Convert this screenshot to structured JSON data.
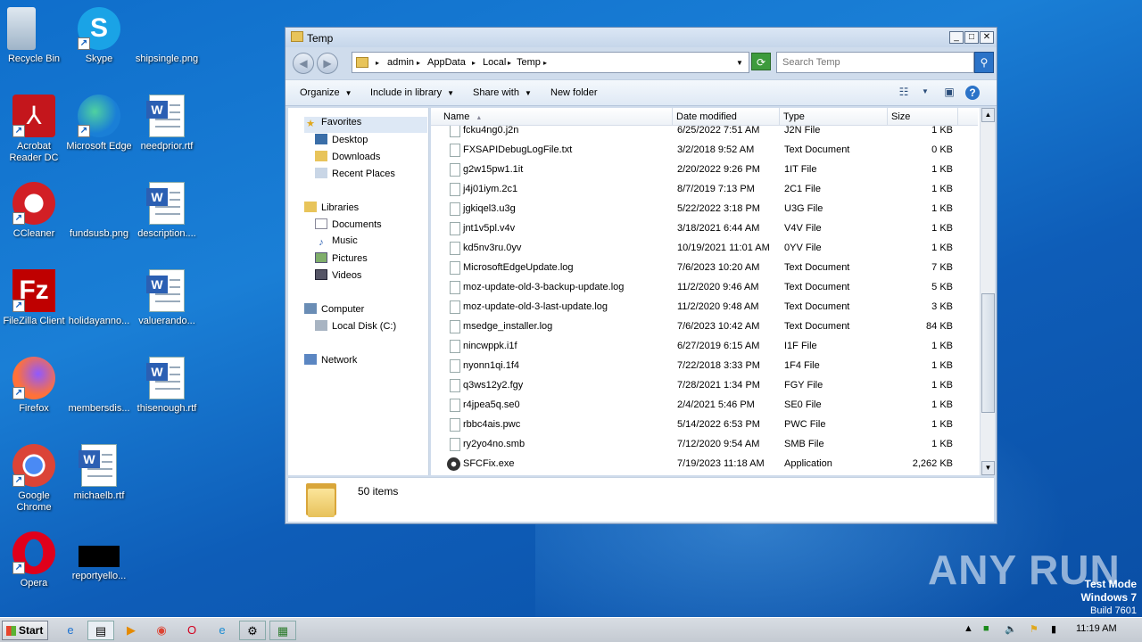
{
  "desktop": {
    "icons": [
      {
        "label": "Recycle Bin",
        "icon": "recycle-bin-icon"
      },
      {
        "label": "Skype",
        "icon": "skype-icon"
      },
      {
        "label": "shipsingle.png",
        "icon": "image-file-icon"
      },
      {
        "label": "Acrobat Reader DC",
        "icon": "acrobat-icon"
      },
      {
        "label": "Microsoft Edge",
        "icon": "edge-icon"
      },
      {
        "label": "needprior.rtf",
        "icon": "word-doc-icon"
      },
      {
        "label": "CCleaner",
        "icon": "ccleaner-icon"
      },
      {
        "label": "fundsusb.png",
        "icon": "image-file-icon"
      },
      {
        "label": "description....",
        "icon": "word-doc-icon"
      },
      {
        "label": "FileZilla Client",
        "icon": "filezilla-icon"
      },
      {
        "label": "holidayanno...",
        "icon": "image-file-icon"
      },
      {
        "label": "valuerando...",
        "icon": "word-doc-icon"
      },
      {
        "label": "Firefox",
        "icon": "firefox-icon"
      },
      {
        "label": "membersdis...",
        "icon": "image-file-icon"
      },
      {
        "label": "thisenough.rtf",
        "icon": "word-doc-icon"
      },
      {
        "label": "Google Chrome",
        "icon": "chrome-icon"
      },
      {
        "label": "michaelb.rtf",
        "icon": "word-doc-icon"
      },
      {
        "label": "Opera",
        "icon": "opera-icon"
      },
      {
        "label": "reportyello...",
        "icon": "black-image-icon"
      }
    ]
  },
  "window": {
    "title": "Temp",
    "controls": {
      "minimize": "_",
      "maximize": "□",
      "close": "✕"
    },
    "breadcrumbs": [
      "admin",
      "AppData",
      "Local",
      "Temp"
    ],
    "search_placeholder": "Search Temp",
    "toolbar": {
      "organize": "Organize",
      "include": "Include in library",
      "share": "Share with",
      "newfolder": "New folder"
    },
    "nav": {
      "favorites": "Favorites",
      "desktop": "Desktop",
      "downloads": "Downloads",
      "recent": "Recent Places",
      "libraries": "Libraries",
      "documents": "Documents",
      "music": "Music",
      "pictures": "Pictures",
      "videos": "Videos",
      "computer": "Computer",
      "localdisk": "Local Disk (C:)",
      "network": "Network"
    },
    "columns": {
      "name": "Name",
      "date": "Date modified",
      "type": "Type",
      "size": "Size"
    },
    "files": [
      {
        "name": "fcku4ng0.j2n",
        "date": "6/25/2022 7:51 AM",
        "type": "J2N File",
        "size": "1 KB"
      },
      {
        "name": "FXSAPIDebugLogFile.txt",
        "date": "3/2/2018 9:52 AM",
        "type": "Text Document",
        "size": "0 KB"
      },
      {
        "name": "g2w15pw1.1it",
        "date": "2/20/2022 9:26 PM",
        "type": "1IT File",
        "size": "1 KB"
      },
      {
        "name": "j4j01iym.2c1",
        "date": "8/7/2019 7:13 PM",
        "type": "2C1 File",
        "size": "1 KB"
      },
      {
        "name": "jgkiqel3.u3g",
        "date": "5/22/2022 3:18 PM",
        "type": "U3G File",
        "size": "1 KB"
      },
      {
        "name": "jnt1v5pl.v4v",
        "date": "3/18/2021 6:44 AM",
        "type": "V4V File",
        "size": "1 KB"
      },
      {
        "name": "kd5nv3ru.0yv",
        "date": "10/19/2021 11:01 AM",
        "type": "0YV File",
        "size": "1 KB"
      },
      {
        "name": "MicrosoftEdgeUpdate.log",
        "date": "7/6/2023 10:20 AM",
        "type": "Text Document",
        "size": "7 KB"
      },
      {
        "name": "moz-update-old-3-backup-update.log",
        "date": "11/2/2020 9:46 AM",
        "type": "Text Document",
        "size": "5 KB"
      },
      {
        "name": "moz-update-old-3-last-update.log",
        "date": "11/2/2020 9:48 AM",
        "type": "Text Document",
        "size": "3 KB"
      },
      {
        "name": "msedge_installer.log",
        "date": "7/6/2023 10:42 AM",
        "type": "Text Document",
        "size": "84 KB"
      },
      {
        "name": "nincwppk.i1f",
        "date": "6/27/2019 6:15 AM",
        "type": "I1F File",
        "size": "1 KB"
      },
      {
        "name": "nyonn1qi.1f4",
        "date": "7/22/2018 3:33 PM",
        "type": "1F4 File",
        "size": "1 KB"
      },
      {
        "name": "q3ws12y2.fgy",
        "date": "7/28/2021 1:34 PM",
        "type": "FGY File",
        "size": "1 KB"
      },
      {
        "name": "r4jpea5q.se0",
        "date": "2/4/2021 5:46 PM",
        "type": "SE0 File",
        "size": "1 KB"
      },
      {
        "name": "rbbc4ais.pwc",
        "date": "5/14/2022 6:53 PM",
        "type": "PWC File",
        "size": "1 KB"
      },
      {
        "name": "ry2yo4no.smb",
        "date": "7/12/2020 9:54 AM",
        "type": "SMB File",
        "size": "1 KB"
      },
      {
        "name": "SFCFix.exe",
        "date": "7/19/2023 11:18 AM",
        "type": "Application",
        "size": "2,262 KB"
      }
    ],
    "status": "50 items"
  },
  "watermark": {
    "text": "ANY RUN",
    "mode": "Test Mode",
    "os": "Windows 7",
    "build": "Build 7601"
  },
  "taskbar": {
    "start": "Start",
    "apps": [
      "ie-icon",
      "explorer-icon",
      "media-player-icon",
      "chrome-icon",
      "opera-icon",
      "edge-icon",
      "sfcfix-icon",
      "task-manager-icon"
    ],
    "clock": "11:19 AM"
  }
}
